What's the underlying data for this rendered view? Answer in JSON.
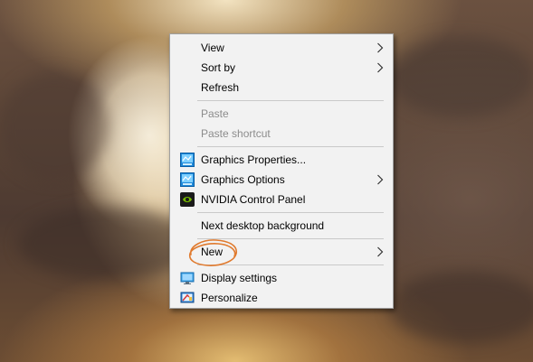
{
  "context_menu": {
    "items": [
      {
        "label": "View",
        "submenu": true,
        "enabled": true,
        "icon": null
      },
      {
        "label": "Sort by",
        "submenu": true,
        "enabled": true,
        "icon": null
      },
      {
        "label": "Refresh",
        "submenu": false,
        "enabled": true,
        "icon": null
      },
      {
        "label": "Paste",
        "submenu": false,
        "enabled": false,
        "icon": null
      },
      {
        "label": "Paste shortcut",
        "submenu": false,
        "enabled": false,
        "icon": null
      },
      {
        "label": "Graphics Properties...",
        "submenu": false,
        "enabled": true,
        "icon": "intel-graphics-icon"
      },
      {
        "label": "Graphics Options",
        "submenu": true,
        "enabled": true,
        "icon": "intel-graphics-icon"
      },
      {
        "label": "NVIDIA Control Panel",
        "submenu": false,
        "enabled": true,
        "icon": "nvidia-icon"
      },
      {
        "label": "Next desktop background",
        "submenu": false,
        "enabled": true,
        "icon": null
      },
      {
        "label": "New",
        "submenu": true,
        "enabled": true,
        "icon": null,
        "highlighted_by_annotation": true
      },
      {
        "label": "Display settings",
        "submenu": false,
        "enabled": true,
        "icon": "display-settings-icon"
      },
      {
        "label": "Personalize",
        "submenu": false,
        "enabled": true,
        "icon": "personalize-icon"
      }
    ]
  },
  "colors": {
    "menu_background": "#f2f2f2",
    "menu_border": "#a0a0a0",
    "separator": "#c9c9c9",
    "disabled_text": "#8c8c8c",
    "annotation_circle": "#e07a2e"
  }
}
